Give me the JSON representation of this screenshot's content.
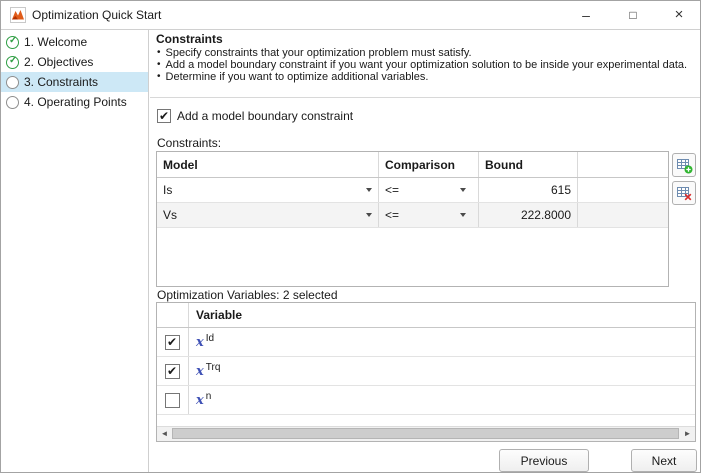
{
  "window": {
    "title": "Optimization Quick Start",
    "controls": {
      "minimize": "–",
      "maximize": "□",
      "close": "×"
    }
  },
  "sidebar": {
    "items": [
      {
        "label": "1. Welcome",
        "status": "complete"
      },
      {
        "label": "2. Objectives",
        "status": "complete"
      },
      {
        "label": "3. Constraints",
        "status": "current"
      },
      {
        "label": "4. Operating Points",
        "status": "pending"
      }
    ]
  },
  "main": {
    "heading": "Constraints",
    "bullets": [
      "Specify constraints that your optimization problem must satisfy.",
      "Add a model boundary constraint if you want your optimization solution to be inside your experimental data.",
      "Determine if you want to optimize additional variables."
    ],
    "bullet_marker": "•",
    "boundary_checkbox": {
      "label": "Add a model boundary constraint",
      "checked": true
    },
    "constraints_label": "Constraints:",
    "constraints_table": {
      "headers": [
        "Model",
        "Comparison",
        "Bound"
      ],
      "rows": [
        {
          "model": "Is",
          "comparison": "<=",
          "bound": "615"
        },
        {
          "model": "Vs",
          "comparison": "<=",
          "bound": "222.8000"
        }
      ]
    },
    "variables_label": "Optimization Variables: 2 selected",
    "variables_table": {
      "header": "Variable",
      "x_symbol": "x",
      "rows": [
        {
          "name": "Id",
          "checked": true
        },
        {
          "name": "Trq",
          "checked": true
        },
        {
          "name": "n",
          "checked": false
        }
      ]
    },
    "scrollbar": {
      "left_arrow": "◄",
      "right_arrow": "►"
    }
  },
  "footer": {
    "previous": "Previous",
    "next": "Next"
  },
  "colors": {
    "selection_blue": "#cde8f6",
    "step_complete_green": "#2f9e44",
    "variable_x_blue": "#3f51b5",
    "add_green": "#2eb52e",
    "delete_red": "#d92b2b",
    "matlab_orange": "#e05c1a"
  }
}
